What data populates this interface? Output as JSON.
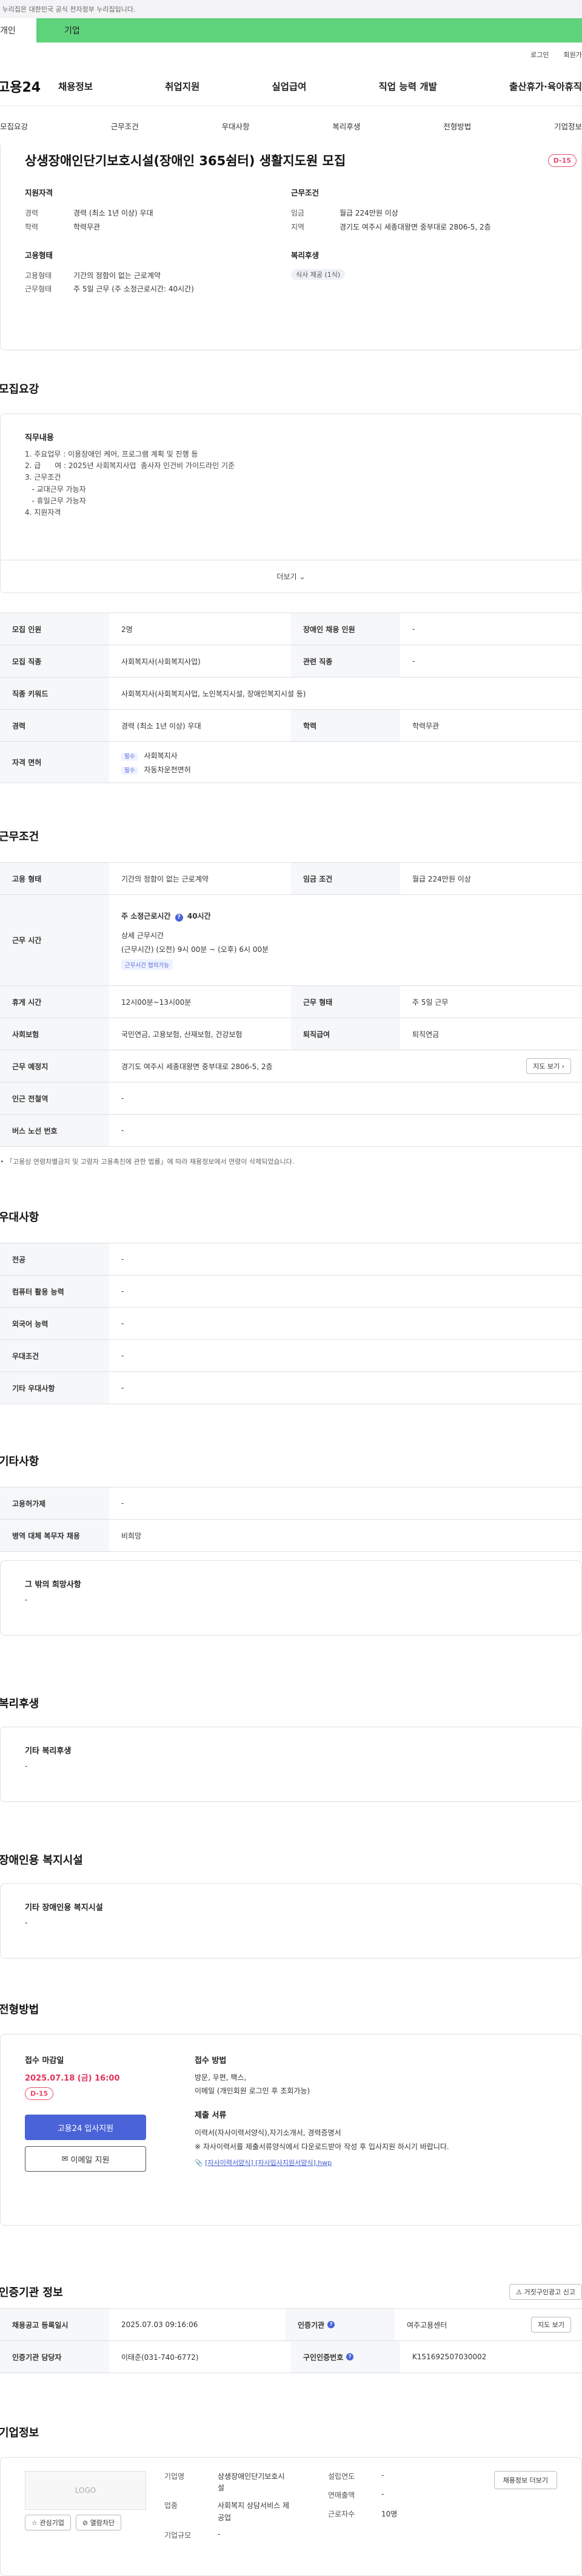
{
  "topbar": {
    "notice": "이 누리집은 대한민국 공식 전자정부 누리집입니다."
  },
  "service_bar": {
    "personal": "개인",
    "corporate": "기업"
  },
  "util": {
    "login": "로그인",
    "signup": "회원가입"
  },
  "logo": "고용24",
  "gnb": [
    "채용정보",
    "취업지원",
    "실업급여",
    "직업 능력 개발",
    "출산휴가·육아휴직"
  ],
  "subnav": [
    "모집요강",
    "근무조건",
    "우대사항",
    "복리후생",
    "전형방법",
    "기업정보"
  ],
  "job": {
    "title": "상생장애인단기보호시설(장애인 365쉼터) 생활지도원 모집",
    "dday": "D-15",
    "qual_title": "지원자격",
    "qual": [
      {
        "k": "경력",
        "v": "경력 (최소 1년 이상) 우대"
      },
      {
        "k": "학력",
        "v": "학력무관"
      }
    ],
    "cond_title": "근무조건",
    "cond": [
      {
        "k": "임금",
        "v": "월급 224만원 이상"
      },
      {
        "k": "지역",
        "v": "경기도 여주시 세종대왕면 중부대로 2806-5, 2층"
      }
    ],
    "emp_title": "고용형태",
    "emp": [
      {
        "k": "고용형태",
        "v": "기간의 정함이 없는 근로계약"
      },
      {
        "k": "근무형태",
        "v": "주 5일 근무 (주 소정근로시간: 40시간)"
      }
    ],
    "welfare_title": "복리후생",
    "welfare_tag": "식사 제공 (1식)"
  },
  "recruit": {
    "title": "모집요강",
    "duty_h": "직무내용",
    "duty_lines": [
      "1. 주요업무 : 이용장애인 케어, 프로그램 계획 및 진행 등",
      "2. 급      여 : 2025년 사회복지사업  종사자 인건비 가이드라인 기준",
      "3. 근무조건",
      "   - 교대근무 가능자",
      "   - 휴일근무 가능자",
      "4. 지원자격"
    ],
    "more": "더보기",
    "rows": [
      {
        "k": "모집 인원",
        "v": "2명",
        "k2": "장애인 채용 인원",
        "v2": "-"
      },
      {
        "k": "모집 직종",
        "v": "사회복지사(사회복지사업)",
        "k2": "관련 직종",
        "v2": "-"
      },
      {
        "k": "직종 키워드",
        "v": "사회복지사(사회복지사업, 노인복지시설, 장애인복지시설 등)"
      },
      {
        "k": "경력",
        "v": "경력 (최소 1년 이상) 우대",
        "k2": "학력",
        "v2": "학력무관"
      }
    ],
    "license_k": "자격 면허",
    "req": "필수",
    "licenses": [
      "사회복지사",
      "자동차운전면허"
    ]
  },
  "work": {
    "title": "근무조건",
    "rows1": [
      {
        "k": "고용 형태",
        "v": "기간의 정함이 없는 근로계약",
        "k2": "임금 조건",
        "v2": "월급 224만원 이상"
      }
    ],
    "time_k": "근무 시간",
    "time_week": "주 소정근로시간",
    "time_week_v": "40시간",
    "time_detail_h": "상세 근무시간",
    "time_detail": "(근무시간) (오전) 9시 00분 ~ (오후) 6시 00분",
    "time_tag": "근무시간 협의가능",
    "rows2": [
      {
        "k": "휴게 시간",
        "v": "12시00분~13시00분",
        "k2": "근무 형태",
        "v2": "주 5일 근무"
      },
      {
        "k": "사회보험",
        "v": "국민연금, 고용보험, 산재보험, 건강보험",
        "k2": "퇴직급여",
        "v2": "퇴직연금"
      }
    ],
    "place_k": "근무 예정지",
    "place_v": "경기도 여주시 세종대왕면 중부대로 2806-5, 2층",
    "map_btn": "지도 보기",
    "rows3": [
      {
        "k": "인근 전철역",
        "v": "-"
      },
      {
        "k": "버스 노선 번호",
        "v": "-"
      }
    ],
    "note": "「고용상 연령차별금지 및 고령자 고용촉진에 관한 법률」에 따라 채용정보에서 연령이 삭제되었습니다."
  },
  "pref": {
    "title": "우대사항",
    "rows": [
      {
        "k": "전공",
        "v": "-"
      },
      {
        "k": "컴퓨터 활용 능력",
        "v": "-"
      },
      {
        "k": "외국어 능력",
        "v": "-"
      },
      {
        "k": "우대조건",
        "v": "-"
      },
      {
        "k": "기타 우대사항",
        "v": "-"
      }
    ]
  },
  "etc": {
    "title": "기타사항",
    "rows": [
      {
        "k": "고용허가제",
        "v": "-"
      },
      {
        "k": "병역 대체 복무자 채용",
        "v": "비희망"
      }
    ],
    "box_h": "그 밖의 희망사항",
    "box_v": "-"
  },
  "benefit": {
    "title": "복리후생",
    "box_h": "기타 복리후생",
    "box_v": "-"
  },
  "disabled": {
    "title": "장애인용 복지시설",
    "box_h": "기타 장애인용 복지시설",
    "box_v": "-"
  },
  "screening": {
    "title": "전형방법",
    "deadline_h": "접수 마감일",
    "deadline": "2025.07.18 (금) 16:00",
    "dday": "D-15",
    "apply_btn": "고용24 입사지원",
    "email_btn": "이메일 지원",
    "method_h": "접수 방법",
    "method": [
      "방문, 우편, 팩스, ",
      "이메일 (개인회원 로그인 후 조회가능)"
    ],
    "docs_h": "제출 서류",
    "docs": [
      "이력서(자사이력서양식),자기소개서, 경력증명서",
      "※ 자사이력서를 제출서류양식에서 다운로드받아 작성 후 입사지원 하시기 바랍니다."
    ],
    "file": "[자사이력서양식] [자사입사지원서양식].hwp"
  },
  "cert": {
    "title": "인증기관 정보",
    "report_btn": "거짓구인광고 신고",
    "rows": [
      {
        "k": "채용공고 등록일시",
        "v": "2025.07.03 09:16:06",
        "k2": "인증기관",
        "v2": "여주고용센터",
        "btn": "지도 보기"
      },
      {
        "k": "인증기관 담당자",
        "v": "이태준(031-740-6772)",
        "k2": "구인인증번호",
        "v2": "K151692507030002"
      }
    ]
  },
  "company": {
    "title": "기업정보",
    "logo": "LOGO",
    "interest_btn": "관심기업",
    "block_btn": "열람차단",
    "name_k": "기업명",
    "name_v": "상생장애인단기보호시설",
    "industry_k": "업종",
    "industry_v": "사회복지 상담서비스 제공업",
    "size_k": "기업규모",
    "size_v": "-",
    "est_k": "설립연도",
    "est_v": "-",
    "sales_k": "연매출액",
    "sales_v": "-",
    "emp_k": "근로자수",
    "emp_v": "10명",
    "jobs_btn": "채용정보 더보기"
  }
}
